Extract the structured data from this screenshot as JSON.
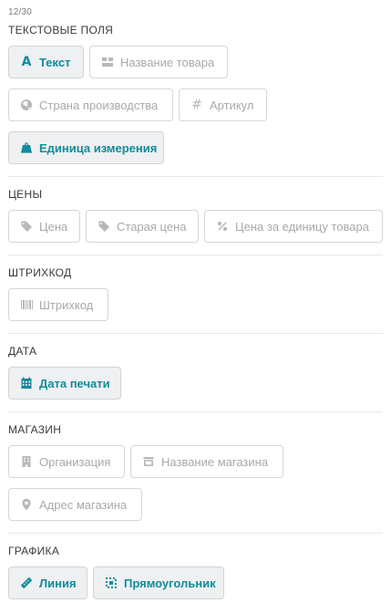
{
  "counter": "12/30",
  "colors": {
    "accent": "#0f8c9c",
    "inactive_text": "#a9a9a9",
    "border": "#d6d6d6",
    "active_bg": "#eef0f1"
  },
  "sections": [
    {
      "title": "ТЕКСТОВЫЕ ПОЛЯ",
      "items": [
        {
          "label": "Текст",
          "icon": "text-icon",
          "active": true
        },
        {
          "label": "Название товара",
          "icon": "boxes-icon",
          "active": false
        },
        {
          "label": "Страна производства",
          "icon": "globe-icon",
          "active": false
        },
        {
          "label": "Артикул",
          "icon": "hash-icon",
          "active": false
        },
        {
          "label": "Единица измерения",
          "icon": "weight-icon",
          "active": true
        }
      ]
    },
    {
      "title": "ЦЕНЫ",
      "items": [
        {
          "label": "Цена",
          "icon": "tag-icon",
          "active": false
        },
        {
          "label": "Старая цена",
          "icon": "tag-icon",
          "active": false
        },
        {
          "label": "Цена за единицу товара",
          "icon": "percent-icon",
          "active": false
        }
      ]
    },
    {
      "title": "ШТРИХКОД",
      "items": [
        {
          "label": "Штрихкод",
          "icon": "barcode-icon",
          "active": false
        }
      ]
    },
    {
      "title": "ДАТА",
      "items": [
        {
          "label": "Дата печати",
          "icon": "calendar-icon",
          "active": true
        }
      ]
    },
    {
      "title": "МАГАЗИН",
      "items": [
        {
          "label": "Организация",
          "icon": "building-icon",
          "active": false
        },
        {
          "label": "Название магазина",
          "icon": "store-icon",
          "active": false
        },
        {
          "label": "Адрес магазина",
          "icon": "map-pin-icon",
          "active": false
        }
      ]
    },
    {
      "title": "ГРАФИКА",
      "items": [
        {
          "label": "Линия",
          "icon": "ruler-icon",
          "active": true
        },
        {
          "label": "Прямоугольник",
          "icon": "rectangle-icon",
          "active": true
        }
      ]
    }
  ]
}
